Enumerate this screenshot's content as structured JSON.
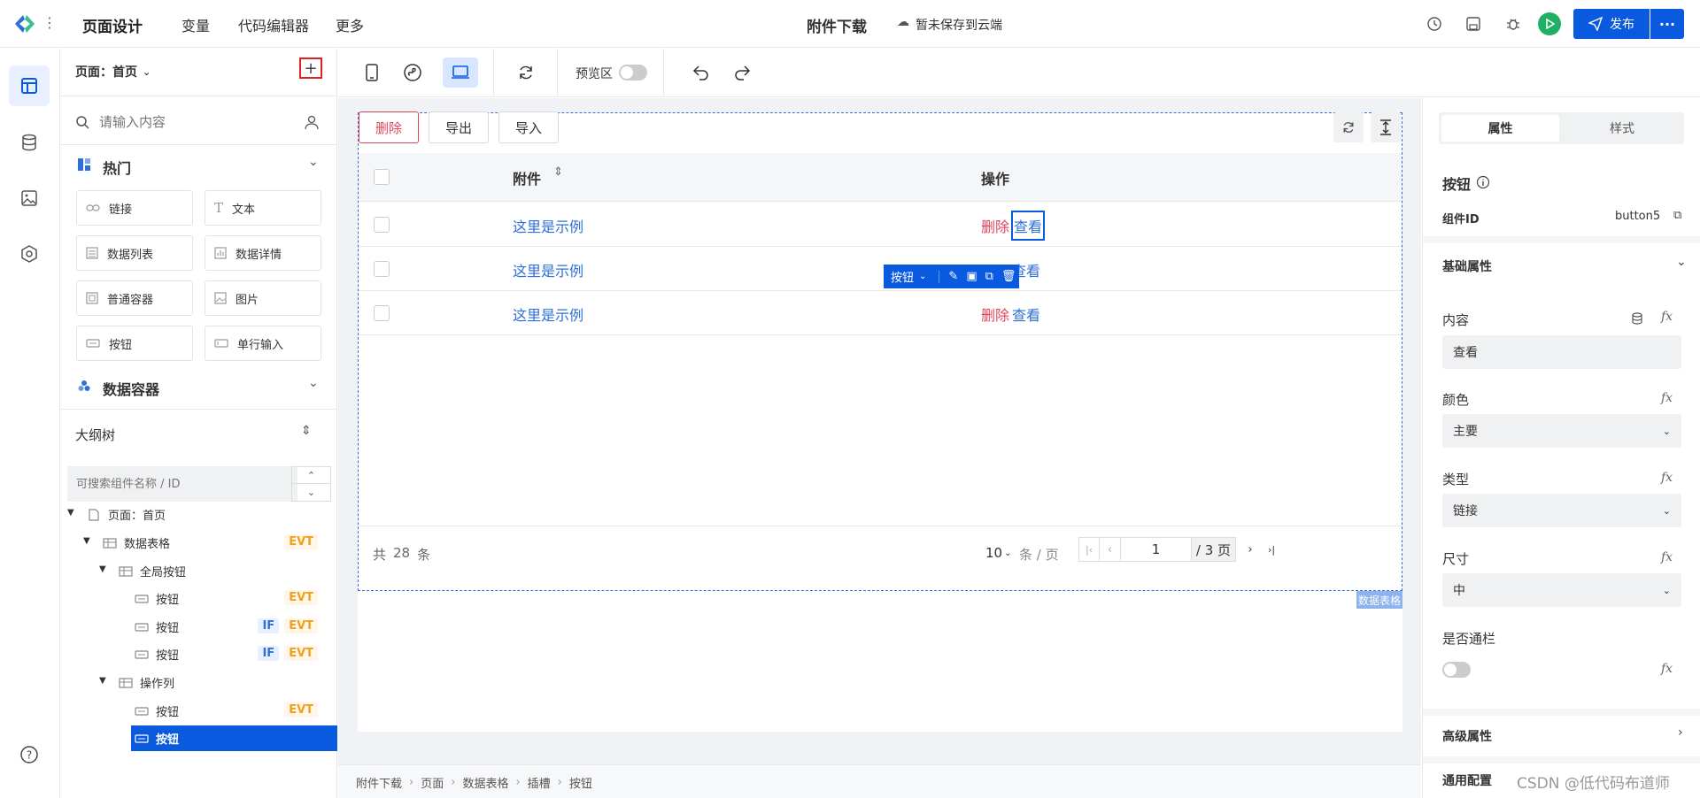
{
  "topbar": {
    "menus": [
      "页面设计",
      "变量",
      "代码编辑器",
      "更多"
    ],
    "doc_title": "附件下载",
    "save_status": "暂未保存到云端",
    "publish_label": "发布",
    "brand_color": "#0a5ae0"
  },
  "left_panel": {
    "page_select": "页面：首页",
    "search_placeholder": "请输入内容",
    "hot_title": "热门",
    "components": [
      "链接",
      "文本",
      "数据列表",
      "数据详情",
      "普通容器",
      "图片",
      "按钮",
      "单行输入"
    ],
    "data_container_title": "数据容器",
    "outline_title": "大纲树",
    "outline_search_placeholder": "可搜索组件名称 / ID",
    "tree": [
      {
        "label": "页面：首页",
        "tags": []
      },
      {
        "label": "数据表格",
        "tags": [
          "EVT"
        ]
      },
      {
        "label": "全局按钮",
        "tags": []
      },
      {
        "label": "按钮",
        "tags": [
          "EVT"
        ]
      },
      {
        "label": "按钮",
        "tags": [
          "IF",
          "EVT"
        ]
      },
      {
        "label": "按钮",
        "tags": [
          "IF",
          "EVT"
        ]
      },
      {
        "label": "操作列",
        "tags": []
      },
      {
        "label": "按钮",
        "tags": [
          "EVT"
        ]
      },
      {
        "label": "按钮",
        "tags": []
      }
    ]
  },
  "toolbar": {
    "preview_label": "预览区"
  },
  "table": {
    "buttons": {
      "delete": "删除",
      "export": "导出",
      "import": "导入"
    },
    "col_attachment": "附件",
    "col_action": "操作",
    "rows": [
      {
        "attachment": "这里是示例",
        "delete": "删除",
        "view": "查看"
      },
      {
        "attachment": "这里是示例",
        "delete": "删除",
        "view": "查看"
      },
      {
        "attachment": "这里是示例",
        "delete": "删除",
        "view": "查看"
      }
    ],
    "total_prefix": "共",
    "total": "28",
    "total_suffix": "条",
    "page_size": "10",
    "page_size_unit": "条 / 页",
    "current_page": "1",
    "page_count": "/ 3 页",
    "tag_label": "数据表格",
    "floating_toolbar_label": "按钮"
  },
  "breadcrumb": [
    "附件下载",
    "页面",
    "数据表格",
    "插槽",
    "按钮"
  ],
  "right_panel": {
    "tabs": [
      "属性",
      "样式"
    ],
    "component_title": "按钮",
    "component_id_label": "组件ID",
    "component_id": "button5",
    "basic_props": "基础属性",
    "content_label": "内容",
    "content_value": "查看",
    "color_label": "颜色",
    "color_value": "主要",
    "type_label": "类型",
    "type_value": "链接",
    "size_label": "尺寸",
    "size_value": "中",
    "block_label": "是否通栏",
    "advanced": "高级属性",
    "general": "通用配置"
  },
  "watermark": "CSDN @低代码布道师"
}
